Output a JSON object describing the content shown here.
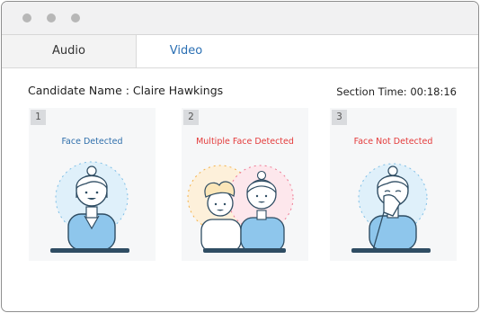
{
  "window": {
    "controls": [
      "window-control",
      "window-control",
      "window-control"
    ]
  },
  "tabs": [
    {
      "label": "Audio",
      "active": false
    },
    {
      "label": "Video",
      "active": true
    }
  ],
  "info": {
    "candidate_text": "Candidate Name : Claire Hawkings",
    "section_time_text": "Section Time: 00:18:16"
  },
  "cards": [
    {
      "number": "1",
      "status": "Face Detected",
      "status_color": "#2f6fab"
    },
    {
      "number": "2",
      "status": "Multiple Face Detected",
      "status_color": "#e43b3b"
    },
    {
      "number": "3",
      "status": "Face Not Detected",
      "status_color": "#e43b3b"
    }
  ],
  "colors": {
    "accent": "#2a6fb3",
    "error": "#e43b3b",
    "face_ring": "#cfe8f6",
    "shirt": "#8ec6ec",
    "base": "#2f4d63"
  }
}
